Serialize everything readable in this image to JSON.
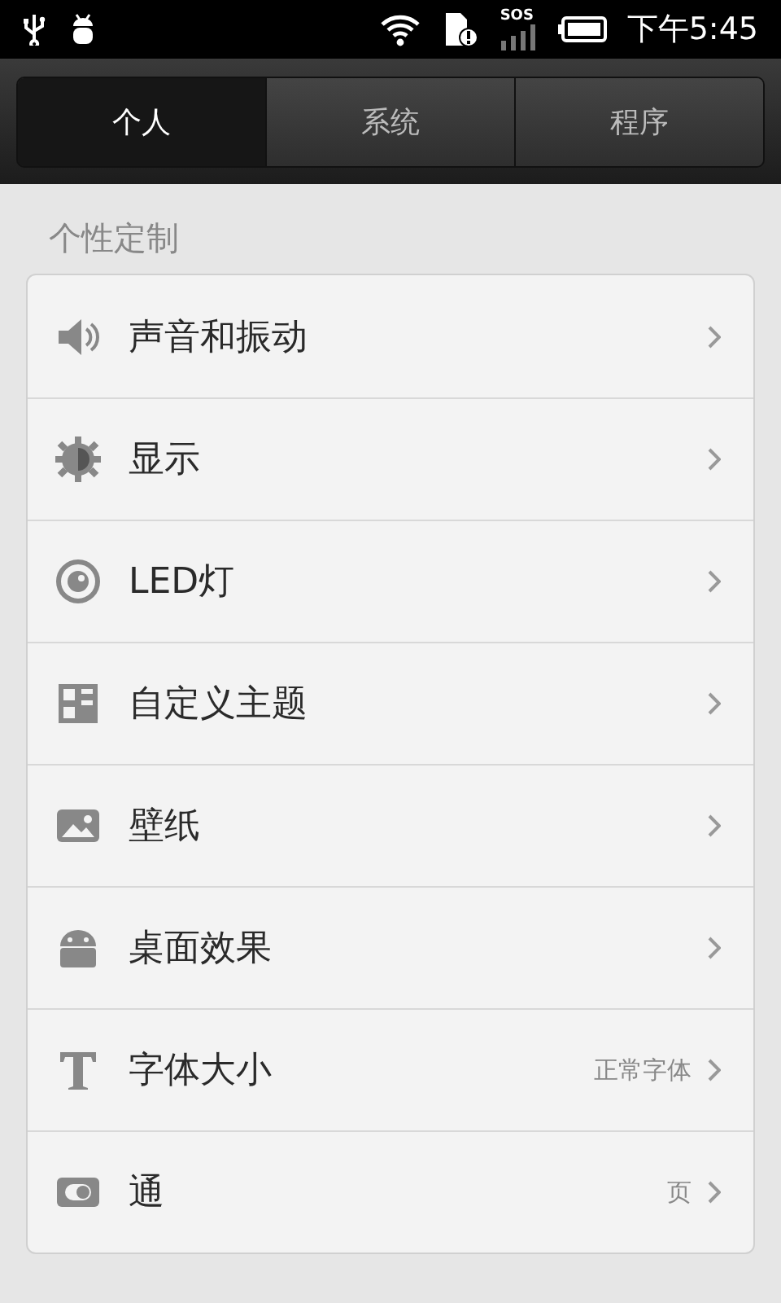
{
  "status_bar": {
    "time": "下午5:45",
    "signal_label": "SOS"
  },
  "tabs": [
    {
      "label": "个人",
      "selected": true
    },
    {
      "label": "系统",
      "selected": false
    },
    {
      "label": "程序",
      "selected": false
    }
  ],
  "section": {
    "title": "个性定制"
  },
  "items": [
    {
      "kind": "sound",
      "label": "声音和振动"
    },
    {
      "kind": "display",
      "label": "显示"
    },
    {
      "kind": "led",
      "label": "LED灯"
    },
    {
      "kind": "theme",
      "label": "自定义主题"
    },
    {
      "kind": "wallpaper",
      "label": "壁纸"
    },
    {
      "kind": "android",
      "label": "桌面效果"
    },
    {
      "kind": "font",
      "label": "字体大小",
      "value": "正常字体"
    },
    {
      "kind": "toggle",
      "label": "通",
      "value": "页"
    }
  ]
}
